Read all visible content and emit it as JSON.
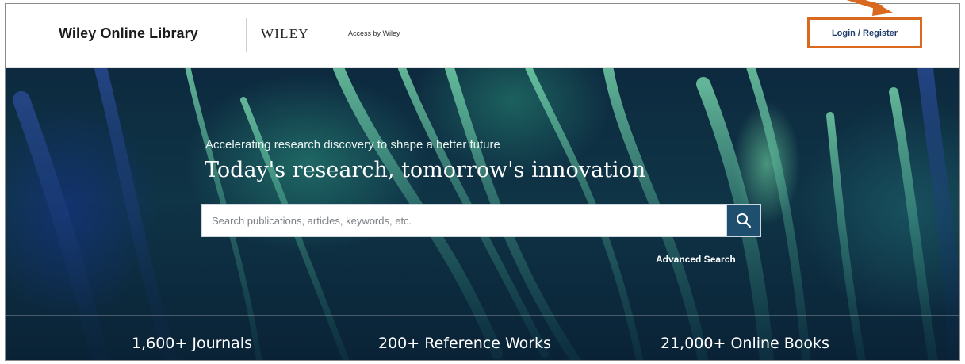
{
  "header": {
    "brand": "Wiley Online Library",
    "publisher_logo": "WILEY",
    "access_text": "Access by Wiley",
    "login_label": "Login / Register"
  },
  "hero": {
    "tagline": "Accelerating research discovery to shape a better future",
    "headline": "Today's research, tomorrow's innovation",
    "search": {
      "placeholder": "Search publications, articles, keywords, etc.",
      "button_icon": "search-icon"
    },
    "advanced_search_label": "Advanced Search"
  },
  "stats": [
    {
      "label": "1,600+ Journals"
    },
    {
      "label": "200+ Reference Works"
    },
    {
      "label": "21,000+ Online Books"
    }
  ],
  "colors": {
    "highlight": "#d9691f",
    "link": "#1e3d6b",
    "search_button": "#1f4f6e"
  }
}
